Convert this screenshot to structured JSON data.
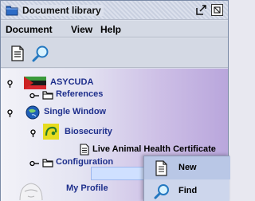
{
  "window": {
    "title": "Document library",
    "icons": {
      "app": "folder-icon",
      "undock": "undock-icon",
      "maximize": "maximize-icon"
    }
  },
  "menubar": {
    "items": [
      "Document",
      "View",
      "Help"
    ]
  },
  "toolbar": {
    "tools": [
      {
        "icon": "document-icon"
      },
      {
        "icon": "search-icon"
      }
    ]
  },
  "tree": {
    "nodes": [
      {
        "label": "ASYCUDA",
        "icon": "flag-icon"
      },
      {
        "label": "References",
        "icon": "folder-icon"
      },
      {
        "label": "Single Window",
        "icon": "globe-icon"
      },
      {
        "label": "Biosecurity",
        "icon": "biosecurity-icon"
      },
      {
        "label": "Live Animal Health Certificate",
        "icon": "document-icon",
        "selected": true
      },
      {
        "label": "Configuration",
        "icon": "folder-icon"
      },
      {
        "label": "My Profile",
        "icon": "avatar-icon"
      }
    ]
  },
  "context_menu": {
    "items": [
      {
        "label": "New",
        "icon": "document-icon",
        "highlighted": true
      },
      {
        "label": "Find",
        "icon": "search-icon"
      }
    ]
  },
  "colors": {
    "tree_label": "#1e2f8c",
    "selection": "#cfe0ff",
    "popup": "#cdd6ec"
  }
}
